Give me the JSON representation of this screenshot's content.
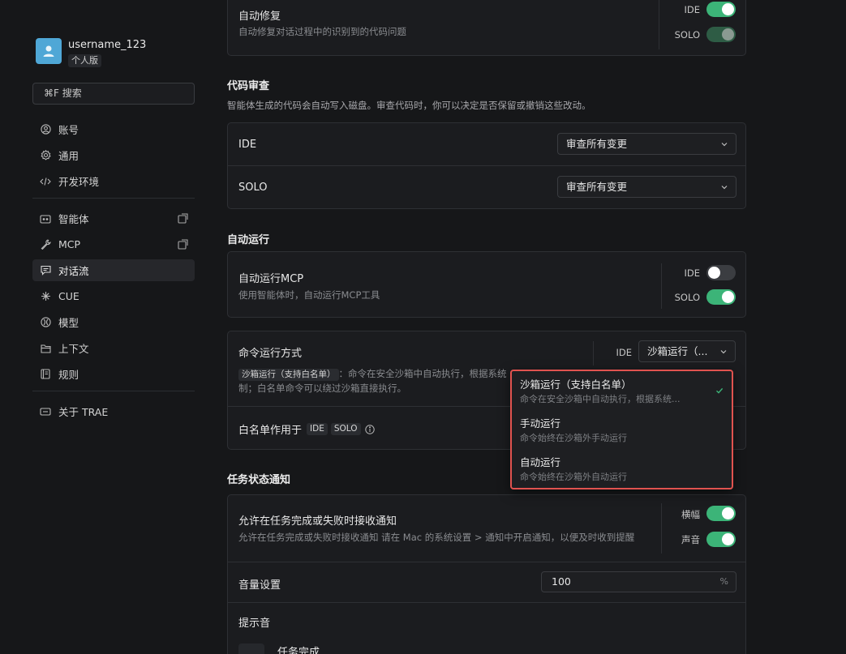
{
  "user": {
    "name": "username_123",
    "plan": "个人版"
  },
  "search": {
    "label": "⌘F 搜索"
  },
  "nav": {
    "group1": [
      {
        "label": "账号",
        "icon": "user-circle-icon"
      },
      {
        "label": "通用",
        "icon": "gear-icon"
      },
      {
        "label": "开发环境",
        "icon": "code-icon"
      }
    ],
    "group2": [
      {
        "label": "智能体",
        "icon": "agent-icon"
      },
      {
        "label": "MCP",
        "icon": "wrench-icon"
      },
      {
        "label": "对话流",
        "icon": "chat-icon"
      },
      {
        "label": "CUE",
        "icon": "sparkle-icon"
      },
      {
        "label": "模型",
        "icon": "model-icon"
      },
      {
        "label": "上下文",
        "icon": "folder-icon"
      },
      {
        "label": "规则",
        "icon": "book-icon"
      }
    ],
    "group3": [
      {
        "label": "关于 TRAE",
        "icon": "info-card-icon"
      }
    ],
    "active": "对话流"
  },
  "autofix": {
    "title": "自动修复",
    "desc": "自动修复对话过程中的识别到的代码问题",
    "ide_label": "IDE",
    "solo_label": "SOLO",
    "ide_on": true,
    "solo_on": true
  },
  "code_review": {
    "title": "代码审查",
    "desc": "智能体生成的代码会自动写入磁盘。审查代码时，你可以决定是否保留或撤销这些改动。",
    "rows": [
      {
        "label": "IDE",
        "value": "审查所有变更"
      },
      {
        "label": "SOLO",
        "value": "审查所有变更"
      }
    ]
  },
  "auto_run": {
    "title": "自动运行",
    "mcp_title": "自动运行MCP",
    "mcp_desc": "使用智能体时，自动运行MCP工具",
    "ide_label": "IDE",
    "solo_label": "SOLO",
    "ide_on": false,
    "solo_on": true,
    "cmd_title": "命令运行方式",
    "cmd_tag": "沙箱运行（支持白名单）",
    "cmd_desc_1": "：命令在安全沙箱中自动执行，根据系统",
    "cmd_desc_2": "制；白名单命令可以绕过沙箱直接执行。",
    "cmd_ide_label": "IDE",
    "cmd_select": "沙箱运行（...",
    "whitelist_label": "白名单作用于",
    "whitelist_tags": [
      "IDE",
      "SOLO"
    ]
  },
  "dropdown": {
    "options": [
      {
        "title": "沙箱运行（支持白名单）",
        "desc": "命令在安全沙箱中自动执行，根据系统...",
        "selected": true
      },
      {
        "title": "手动运行",
        "desc": "命令始终在沙箱外手动运行",
        "selected": false
      },
      {
        "title": "自动运行",
        "desc": "命令始终在沙箱外自动运行",
        "selected": false
      }
    ]
  },
  "notify": {
    "title": "任务状态通知",
    "allow_title": "允许在任务完成或失败时接收通知",
    "allow_desc": "允许在任务完成或失败时接收通知 请在 Mac 的系统设置 > 通知中开启通知，以便及时收到提醒",
    "banner_label": "横幅",
    "sound_label": "声音",
    "volume_label": "音量设置",
    "volume_value": "100",
    "volume_unit": "%",
    "prompt_sound_label": "提示音",
    "task_done_label": "任务完成"
  },
  "colors": {
    "accent_green": "#3cb478",
    "highlight_red": "#e0534f"
  }
}
